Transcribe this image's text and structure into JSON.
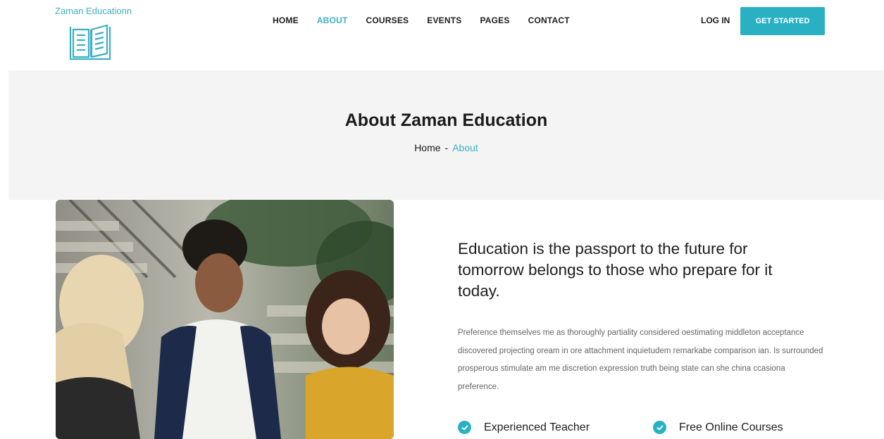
{
  "brand": {
    "name": "Zaman Educationn",
    "icon": "open-book-icon",
    "color": "#3bb0c3"
  },
  "nav": {
    "items": [
      {
        "label": "HOME"
      },
      {
        "label": "ABOUT"
      },
      {
        "label": "COURSES"
      },
      {
        "label": "EVENTS"
      },
      {
        "label": "PAGES"
      },
      {
        "label": "CONTACT"
      }
    ],
    "active": "ABOUT",
    "login": "LOG IN",
    "cta": "GET STARTED"
  },
  "banner": {
    "title": "About Zaman Education",
    "breadcrumb": {
      "home": "Home",
      "separator": "-",
      "current": "About"
    }
  },
  "about": {
    "quote": "Education is the passport to the future for tomorrow belongs to those who prepare for it today.",
    "description": "Preference themselves me as thoroughly partiality considered oestimating middleton acceptance discovered projecting oream in ore attachment inquietudem remarkabe comparison ian. Is surrounded prosperous stimulate am me discretion expression truth being state can she china ccasiona preference.",
    "features": [
      {
        "label": "Experienced Teacher",
        "icon": "check-circle-icon"
      },
      {
        "label": "Free Online Courses",
        "icon": "check-circle-icon"
      }
    ]
  },
  "colors": {
    "accent": "#29b1c3",
    "banner_bg": "#f4f4f4",
    "text": "#1d1d1d"
  }
}
